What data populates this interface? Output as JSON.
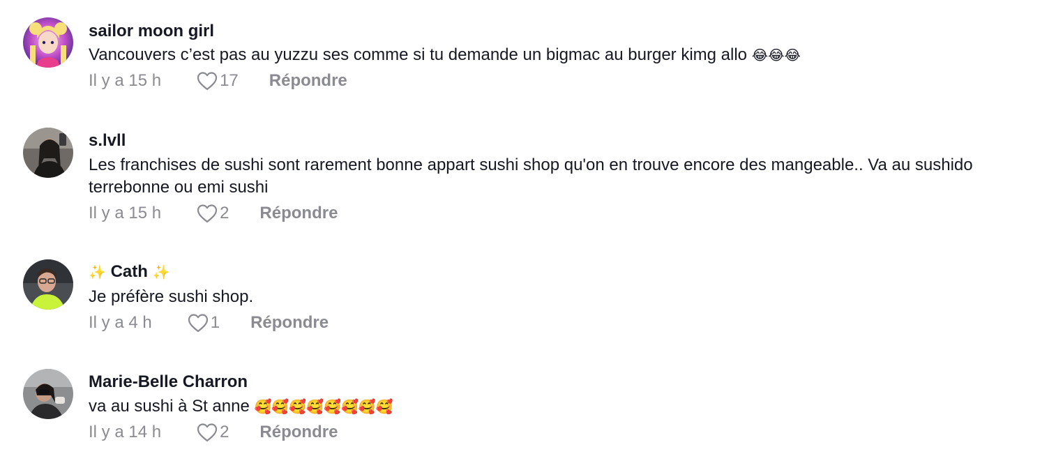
{
  "comments": [
    {
      "username": "sailor moon girl",
      "text": "Vancouvers c’est pas au yuzzu ses comme si tu demande un bigmac au burger kimg allo",
      "emoji": "😂😂😂",
      "time": "Il y a 15 h",
      "likes": "17",
      "reply_label": "Répondre"
    },
    {
      "username": "s.lvll",
      "text": "Les franchises de sushi sont rarement bonne appart sushi shop qu'on en trouve encore des mangeable.. Va au sushido terrebonne ou emi sushi",
      "emoji": "",
      "time": "Il y a 15 h",
      "likes": "2",
      "reply_label": "Répondre"
    },
    {
      "username_prefix": "✨",
      "username": "Cath",
      "username_suffix": "✨",
      "text": "Je préfère sushi shop.",
      "emoji": "",
      "time": "Il y a 4 h",
      "likes": "1",
      "reply_label": "Répondre"
    },
    {
      "username": "Marie-Belle Charron",
      "text": "va au sushi à St anne",
      "emoji": "🥰🥰🥰🥰🥰🥰🥰🥰",
      "time": "Il y a 14 h",
      "likes": "2",
      "reply_label": "Répondre"
    }
  ],
  "icons": {
    "like": "heart-outline-icon"
  },
  "colors": {
    "text_primary": "#161823",
    "text_secondary": "#8a8b91",
    "background": "#ffffff"
  }
}
